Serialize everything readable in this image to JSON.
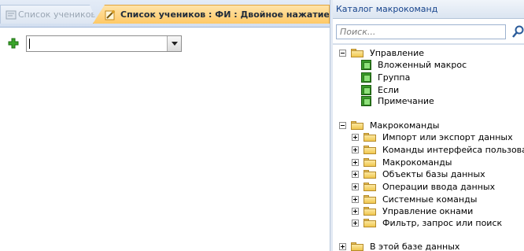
{
  "tabs": [
    {
      "label": "Список учеников",
      "active": false
    },
    {
      "label": "Список учеников : ФИ : Двойное нажатие кнопки",
      "active": true
    }
  ],
  "macro_editor": {
    "action_value": ""
  },
  "catalog": {
    "title": "Каталог макрокоманд",
    "search_placeholder": "Поиск...",
    "groups": [
      {
        "label": "Управление",
        "expanded": true,
        "children": [
          "Вложенный макрос",
          "Группа",
          "Если",
          "Примечание"
        ]
      },
      {
        "label": "Макрокоманды",
        "expanded": true,
        "children": [
          "Импорт или экспорт данных",
          "Команды интерфейса пользовател",
          "Макрокоманды",
          "Объекты базы данных",
          "Операции ввода данных",
          "Системные команды",
          "Управление окнами",
          "Фильтр, запрос или поиск"
        ]
      },
      {
        "label": "В этой базе данных",
        "expanded": false,
        "children": []
      }
    ]
  },
  "colors": {
    "active_tab": "#ffc966",
    "header_text": "#15428b",
    "add_icon": "#3aa52a",
    "folder": "#f1c84f"
  },
  "icons": {
    "add": "plus-icon",
    "folder": "folder-icon",
    "program_flow_item": "green-block-icon",
    "search": "magnifier-icon",
    "combo_dropdown": "chevron-down-icon"
  }
}
